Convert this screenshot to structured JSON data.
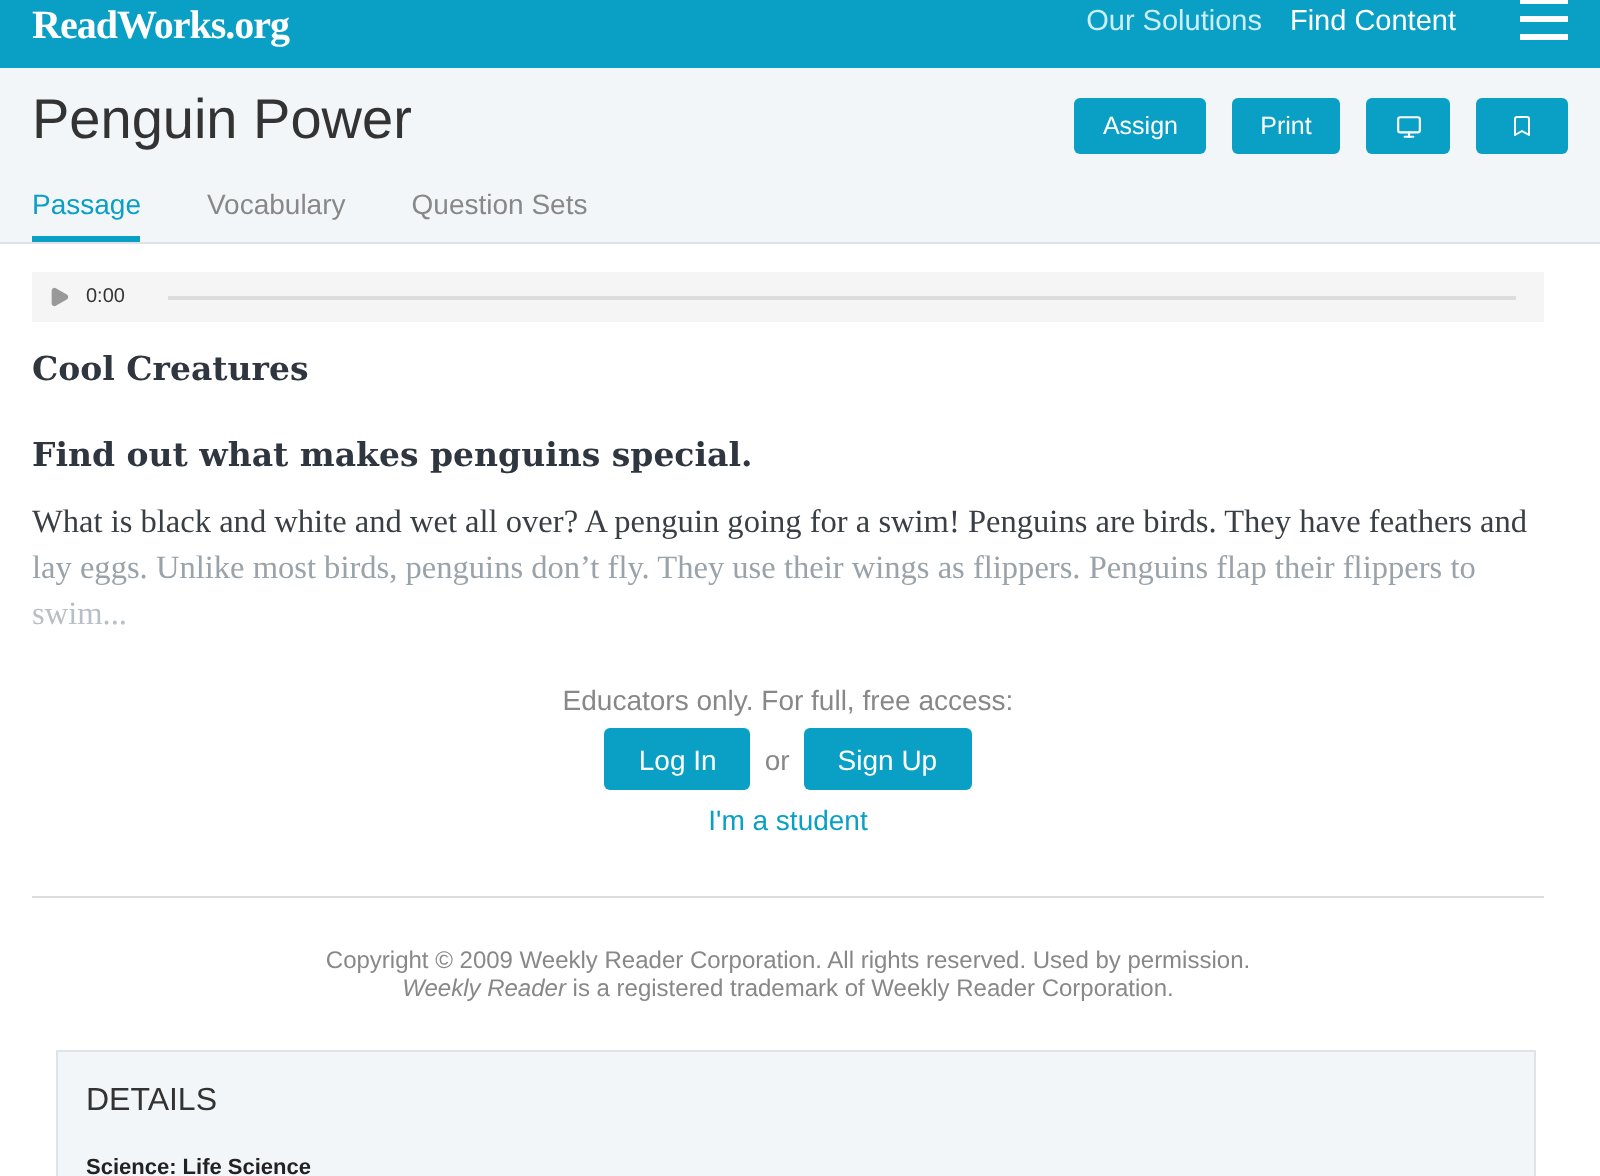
{
  "header": {
    "logo": "ReadWorks.org",
    "nav": [
      "Our Solutions",
      "Find Content"
    ]
  },
  "title": "Penguin Power",
  "actions": [
    {
      "kind": "text",
      "label": "Assign"
    },
    {
      "kind": "text",
      "label": "Print"
    },
    {
      "kind": "monitor"
    },
    {
      "kind": "bookmark"
    }
  ],
  "tabs": [
    {
      "label": "Passage",
      "selected": true
    },
    {
      "label": "Vocabulary",
      "selected": false
    },
    {
      "label": "Question Sets",
      "selected": false
    }
  ],
  "audio": {
    "time": "0:00"
  },
  "passage": {
    "title": "Cool Creatures",
    "subtitle": "Find out what makes penguins special.",
    "lines": [
      "What is black and white and wet all over? A penguin going for a swim! Penguins are birds. They have feathers and",
      "lay eggs. Unlike most birds, penguins don’t fly. They use their wings as flippers. Penguins flap their flippers to",
      "swim..."
    ]
  },
  "access": {
    "prompt": "Educators only. For full, free access:",
    "login": "Log In",
    "or": "or",
    "signup": "Sign Up",
    "student": "I'm a student"
  },
  "copyright": [
    "Copyright © 2009 Weekly Reader Corporation. All rights reserved. Used by permission.",
    "*Weekly Reader* is a registered trademark of Weekly Reader Corporation."
  ],
  "details": {
    "heading": "DETAILS",
    "subject": "Science: Life Science"
  }
}
